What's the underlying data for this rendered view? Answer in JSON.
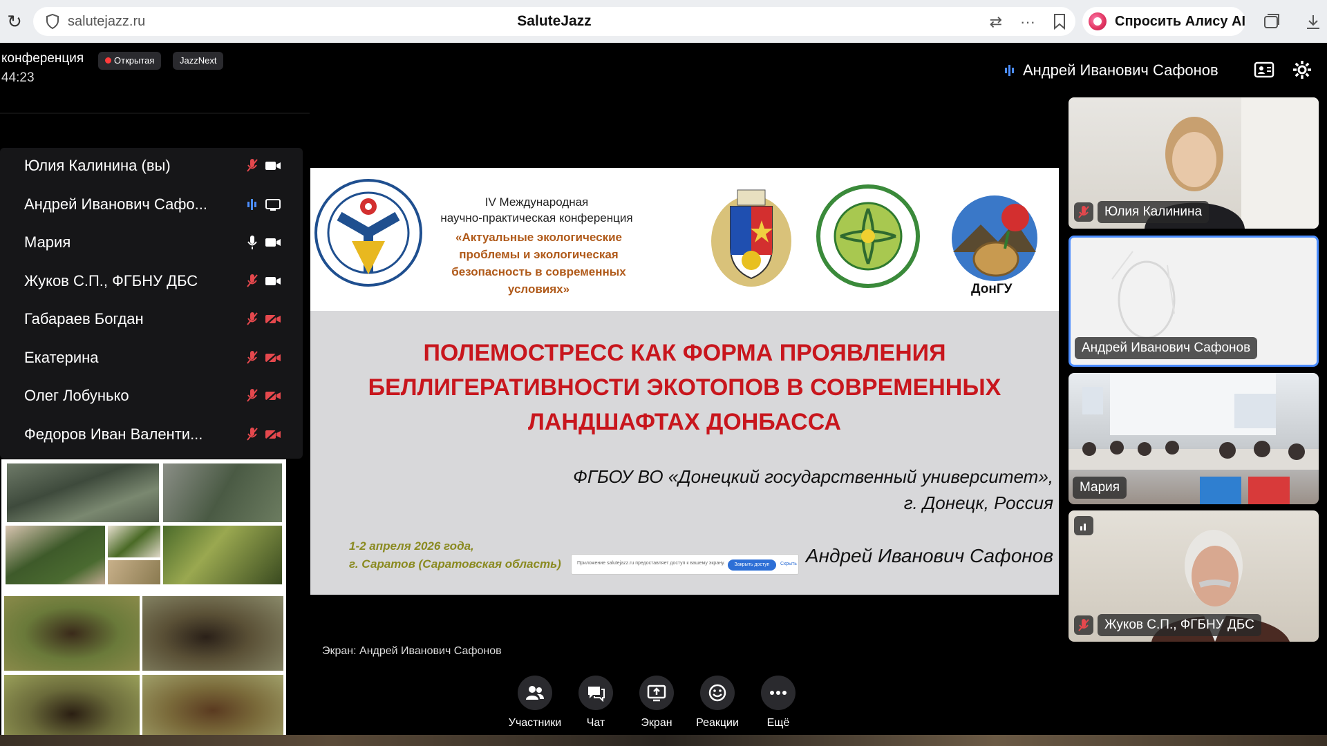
{
  "browser": {
    "url": "salutejazz.ru",
    "tab_title": "SaluteJazz",
    "alice_label": "Спросить Алису AI",
    "menu_dots": "···"
  },
  "header": {
    "conference_title": "конференция",
    "badge_open": "Открытая",
    "badge_next": "JazzNext",
    "timer": "44:23",
    "speaker": "Андрей Иванович Сафонов"
  },
  "participants": [
    {
      "name": "Юлия Калинина (вы)",
      "mic": "off",
      "cam": "on"
    },
    {
      "name": "Андрей Иванович Сафо...",
      "mic": "speaking",
      "cam": "screen"
    },
    {
      "name": "Мария",
      "mic": "on",
      "cam": "on"
    },
    {
      "name": "Жуков С.П., ФГБНУ ДБС",
      "mic": "off",
      "cam": "on"
    },
    {
      "name": "Габараев Богдан",
      "mic": "off",
      "cam": "off"
    },
    {
      "name": "Екатерина",
      "mic": "off",
      "cam": "off"
    },
    {
      "name": "Олег Лобунько",
      "mic": "off",
      "cam": "off"
    },
    {
      "name": "Федоров Иван Валенти...",
      "mic": "off",
      "cam": "off"
    }
  ],
  "slide": {
    "conf_line1": "IV Международная",
    "conf_line2": "научно-практическая конференция",
    "conf_sub": "«Актуальные экологические проблемы и экологическая безопасность в современных условиях»",
    "logo_label": "ДонГУ",
    "title": "ПОЛЕМОСТРЕСС КАК ФОРМА ПРОЯВЛЕНИЯ БЕЛЛИГЕРАТИВНОСТИ ЭКОТОПОВ В СОВРЕМЕННЫХ ЛАНДШАФТАХ ДОНБАССА",
    "univ_line1": "ФГБОУ ВО «Донецкий государственный университет»,",
    "univ_line2": "г. Донецк, Россия",
    "date_line1": "1-2 апреля 2026 года,",
    "date_line2": "г. Саратов (Саратовская область)",
    "author": "Андрей Иванович Сафонов",
    "share_text": "Приложение salutejazz.ru предоставляет доступ к вашему экрану.",
    "share_button": "Закрыть доступ",
    "share_hide": "Скрыть"
  },
  "screen_label": "Экран: Андрей Иванович Сафонов",
  "toolbar": [
    {
      "label": "Участники",
      "icon": "participants-icon"
    },
    {
      "label": "Чат",
      "icon": "chat-icon"
    },
    {
      "label": "Экран",
      "icon": "screen-share-icon"
    },
    {
      "label": "Реакции",
      "icon": "reactions-icon"
    },
    {
      "label": "Ещё",
      "icon": "more-icon"
    }
  ],
  "tiles": [
    {
      "name": "Юлия Калинина",
      "mic": "off"
    },
    {
      "name": "Андрей Иванович Сафонов",
      "mic": "none"
    },
    {
      "name": "Мария",
      "mic": "none"
    },
    {
      "name": "Жуков С.П., ФГБНУ ДБС",
      "mic": "off"
    }
  ],
  "colors": {
    "accent_red": "#c8161d",
    "mic_off": "#e5484d",
    "speaking": "#4c8dff",
    "toolbar_btn": "#2a2a2e"
  }
}
